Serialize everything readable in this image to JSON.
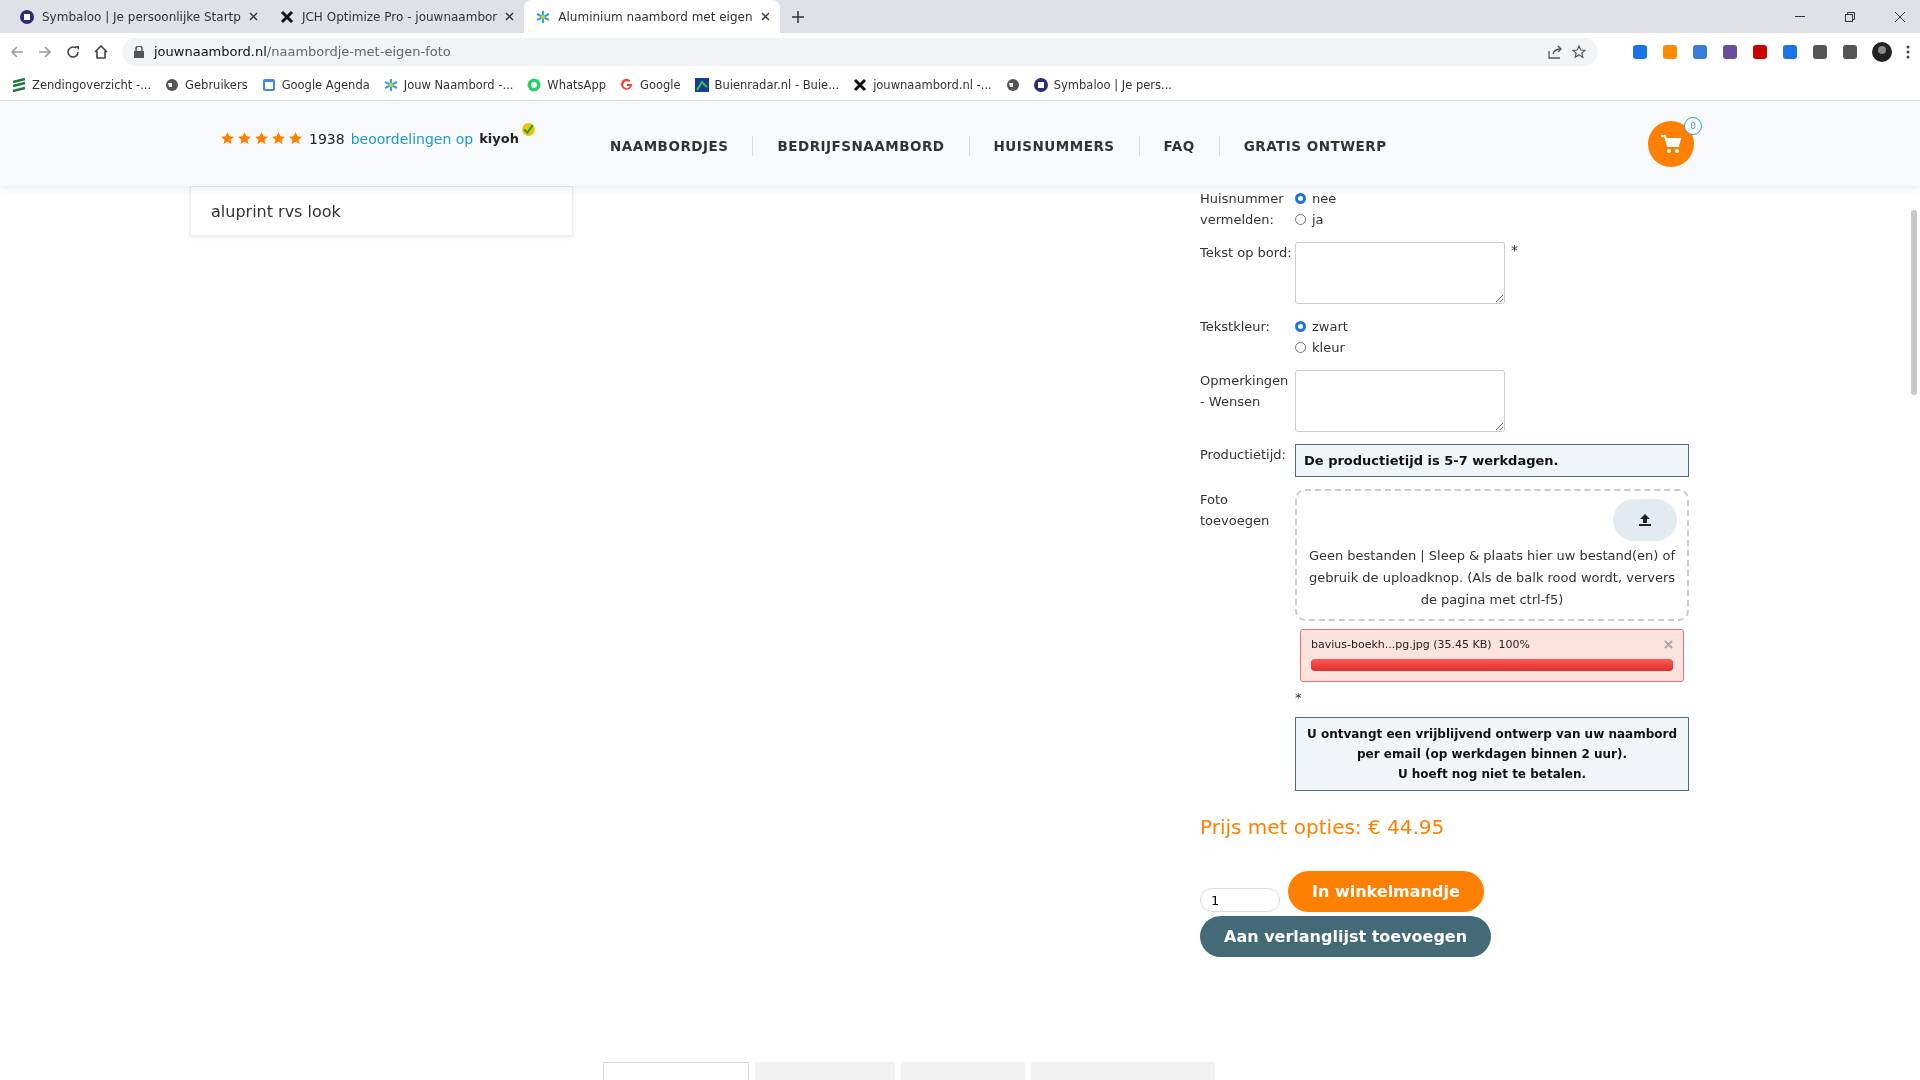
{
  "browser": {
    "tabs": [
      {
        "title": "Symbaloo | Je persoonlijke Startp",
        "selected": false
      },
      {
        "title": "JCH Optimize Pro - jouwnaambor",
        "selected": false
      },
      {
        "title": "Aluminium naambord met eigen",
        "selected": true
      }
    ],
    "url_domain": "jouwnaambord.nl",
    "url_path": "/naambordje-met-eigen-foto",
    "bookmarks": [
      {
        "label": "Zendingoverzicht -..."
      },
      {
        "label": "Gebruikers"
      },
      {
        "label": "Google Agenda"
      },
      {
        "label": "Jouw Naambord -..."
      },
      {
        "label": "WhatsApp"
      },
      {
        "label": "Google"
      },
      {
        "label": "Buienradar.nl - Buie..."
      },
      {
        "label": "jouwnaambord.nl -..."
      },
      {
        "kind": "icon"
      },
      {
        "label": "Symbaloo | Je pers..."
      }
    ]
  },
  "header": {
    "stars": 5,
    "review_count": "1938",
    "review_link": "beoordelingen op",
    "brand": "kiyoh",
    "nav": [
      "NAAMBORDJES",
      "BEDRIJFSNAAMBORD",
      "HUISNUMMERS",
      "FAQ",
      "GRATIS ONTWERP"
    ],
    "cart_count": "0"
  },
  "sidebar_item": "aluprint rvs look",
  "page_tabs": [
    {
      "selected": true
    },
    {
      "selected": false
    },
    {
      "selected": false
    },
    {
      "selected": false
    }
  ],
  "form": {
    "fields": [
      {
        "kind": "radio",
        "label": "Huisnummer vermelden:",
        "options": [
          {
            "label": "nee",
            "selected": true
          },
          {
            "label": "ja",
            "selected": false
          }
        ]
      },
      {
        "kind": "textarea",
        "label": "Tekst op bord:",
        "required": true
      },
      {
        "kind": "radio",
        "label": "Tekstkleur:",
        "options": [
          {
            "label": "zwart",
            "selected": true
          },
          {
            "label": "kleur",
            "selected": false
          }
        ]
      },
      {
        "kind": "textarea",
        "label": "Opmerkingen - Wensen",
        "required": false
      },
      {
        "kind": "info",
        "label": "Productietijd:",
        "text": "De productietijd is 5-7 werkdagen."
      },
      {
        "kind": "upload",
        "label": "Foto toevoegen",
        "hint": "Geen bestanden | Sleep & plaats hier uw bestand(en) of gebruik de uploadknop. (Als de balk rood wordt, ververs de pagina met ctrl-f5)",
        "file": {
          "name": "bavius-boekh...pg.jpg (35.45 KB)",
          "percent": "100%",
          "level": 1
        }
      }
    ],
    "required_mark": "*",
    "notice": [
      "U ontvangt een vrijblijvend ontwerp van uw naambord",
      "per email (op werkdagen binnen 2 uur).",
      "U hoeft nog niet te betalen."
    ],
    "price": "Prijs met opties: € 44.95",
    "quantity": "1",
    "add_to_cart": "In winkelmandje",
    "wishlist": "Aan verlanglijst toevoegen"
  }
}
